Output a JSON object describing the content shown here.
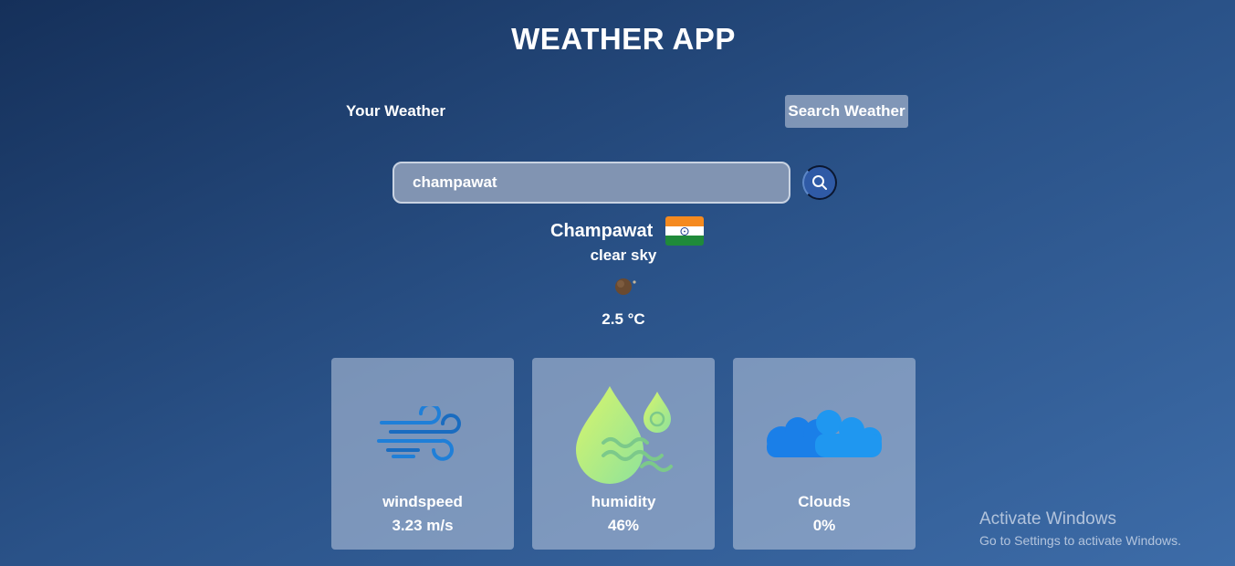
{
  "header": {
    "title": "WEATHER APP"
  },
  "tabs": {
    "your_weather": "Your Weather",
    "search_weather": "Search Weather"
  },
  "search": {
    "value": "champawat",
    "placeholder": ""
  },
  "current": {
    "city": "Champawat",
    "country_flag": "india-flag-icon",
    "description": "clear sky",
    "icon": "clear-night-icon",
    "temperature": "2.5 °C"
  },
  "cards": [
    {
      "label": "windspeed",
      "value": "3.23 m/s",
      "icon": "wind-icon"
    },
    {
      "label": "humidity",
      "value": "46%",
      "icon": "humidity-icon"
    },
    {
      "label": "Clouds",
      "value": "0%",
      "icon": "cloud-icon"
    }
  ],
  "system": {
    "activate_title": "Activate Windows",
    "activate_subtitle": "Go to Settings to activate Windows."
  },
  "colors": {
    "background_top": "#15305a",
    "background_bottom": "#3d6ca8",
    "card_bg": "#adbdd7",
    "search_btn": "#2f5aa6"
  }
}
